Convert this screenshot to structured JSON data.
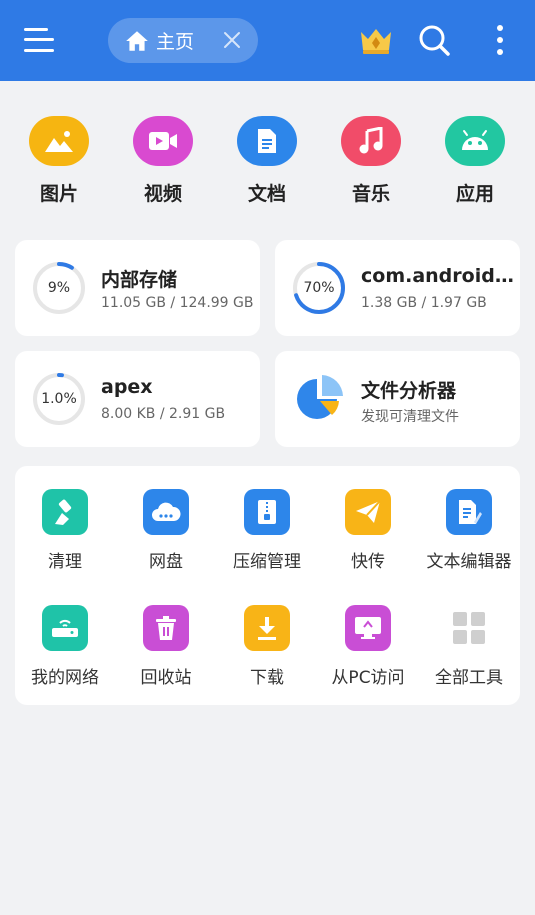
{
  "topbar": {
    "tab_label": "主页",
    "menu_icon": "menu-icon",
    "home_icon": "home-icon",
    "close_icon": "close-icon",
    "premium_icon": "crown-icon",
    "search_icon": "search-icon",
    "more_icon": "more-vertical-icon"
  },
  "categories": [
    {
      "label": "图片",
      "icon": "image-icon",
      "color": "#f6b511"
    },
    {
      "label": "视频",
      "icon": "video-icon",
      "color": "#d94ad0"
    },
    {
      "label": "文档",
      "icon": "document-icon",
      "color": "#2d86ea"
    },
    {
      "label": "音乐",
      "icon": "music-icon",
      "color": "#f14c69"
    },
    {
      "label": "应用",
      "icon": "android-icon",
      "color": "#22c7a1"
    }
  ],
  "storage": {
    "internal": {
      "title": "内部存储",
      "sub": "11.05 GB / 124.99 GB",
      "percent_label": "9%",
      "percent": 9
    },
    "media": {
      "title": "com.android.me...",
      "sub": "1.38 GB / 1.97 GB",
      "percent_label": "70%",
      "percent": 70
    },
    "apex": {
      "title": "apex",
      "sub": "8.00 KB / 2.91 GB",
      "percent_label": "1.0%",
      "percent": 1
    },
    "analyzer": {
      "title": "文件分析器",
      "sub": "发现可清理文件",
      "icon": "pie-chart-icon"
    }
  },
  "tools": [
    {
      "label": "清理",
      "icon": "broom-icon",
      "color": "#1fc3a8"
    },
    {
      "label": "网盘",
      "icon": "cloud-icon",
      "color": "#2d86ea"
    },
    {
      "label": "压缩管理",
      "icon": "zip-icon",
      "color": "#2d86ea"
    },
    {
      "label": "快传",
      "icon": "send-icon",
      "color": "#f8b417"
    },
    {
      "label": "文本编辑器",
      "icon": "text-editor-icon",
      "color": "#2d86ea"
    },
    {
      "label": "我的网络",
      "icon": "router-icon",
      "color": "#1fc3a8"
    },
    {
      "label": "回收站",
      "icon": "trash-icon",
      "color": "#c94ed5"
    },
    {
      "label": "下载",
      "icon": "download-icon",
      "color": "#f8b417"
    },
    {
      "label": "从PC访问",
      "icon": "pc-access-icon",
      "color": "#c94ed5"
    },
    {
      "label": "全部工具",
      "icon": "grid-icon",
      "color": "#cfcfcf"
    }
  ],
  "colors": {
    "primary": "#2f7ae5",
    "ring_track": "#e6e6e6",
    "background": "#f1f2f4"
  }
}
